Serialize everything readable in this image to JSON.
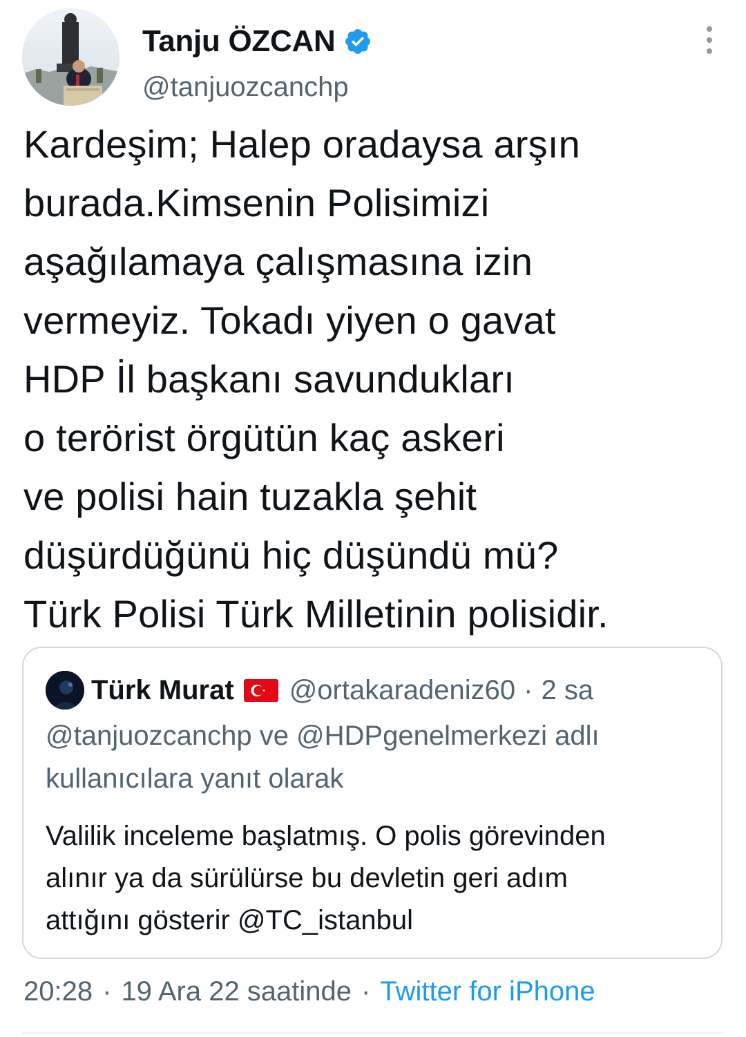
{
  "author": {
    "display_name": "Tanju ÖZCAN",
    "handle": "@tanjuozcanchp",
    "verified_icon": "verified-badge-icon"
  },
  "tweet": {
    "lines": [
      "Kardeşim; Halep oradaysa arşın",
      "burada.Kimsenin Polisimizi",
      "aşağılamaya çalışmasına izin",
      "vermeyiz. Tokadı yiyen o gavat",
      "HDP İl başkanı savundukları",
      "o terörist örgütün kaç askeri",
      "ve polisi hain tuzakla şehit",
      "düşürdüğünü hiç düşündü mü?",
      "Türk Polisi Türk Milletinin polisidir."
    ]
  },
  "quoted_tweet": {
    "display_name": "Türk Murat",
    "flag_icon": "turkey-flag-icon",
    "handle": "@ortakaradeniz60",
    "separator": "·",
    "time": "2 sa",
    "reply_context": [
      "@tanjuozcanchp ve @HDPgenelmerkezi adlı",
      "kullanıcılara yanıt olarak"
    ],
    "text_lines": [
      "Valilik inceleme başlatmış. O polis görevinden",
      "alınır ya da sürülürse bu devletin geri adım",
      "attığını gösterir @TC_istanbul"
    ]
  },
  "meta": {
    "time": "20:28",
    "separator": "·",
    "date": "19 Ara 22 saatinde",
    "source": "Twitter for iPhone"
  },
  "colors": {
    "text_primary": "#0f1419",
    "text_secondary": "#536471",
    "accent": "#1d9bf0",
    "border": "#cfd9de"
  }
}
